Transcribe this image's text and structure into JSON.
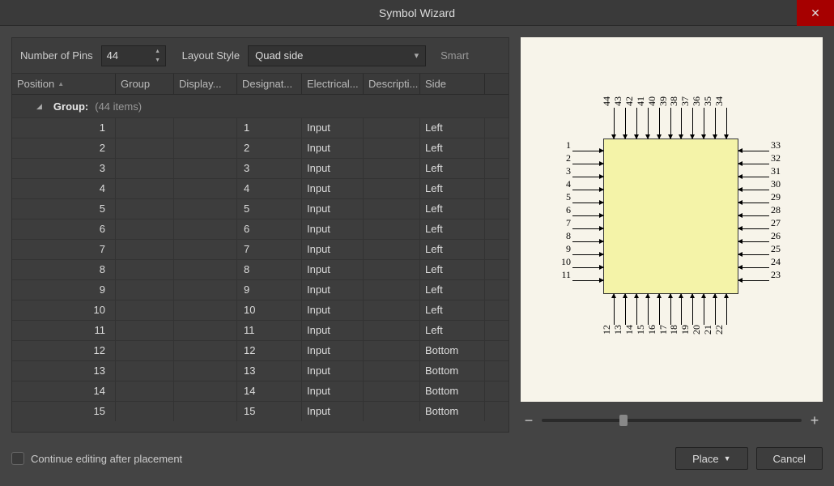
{
  "title": "Symbol Wizard",
  "toolbar": {
    "pins_label": "Number of Pins",
    "pins_value": "44",
    "layout_label": "Layout Style",
    "layout_value": "Quad side",
    "smart": "Smart"
  },
  "columns": {
    "position": "Position",
    "group": "Group",
    "display": "Display...",
    "designator": "Designat...",
    "electrical": "Electrical...",
    "description": "Descripti...",
    "side": "Side"
  },
  "group_header": {
    "label": "Group:",
    "count": "(44 items)"
  },
  "rows": [
    {
      "pos": "1",
      "desig": "1",
      "elec": "Input",
      "side": "Left"
    },
    {
      "pos": "2",
      "desig": "2",
      "elec": "Input",
      "side": "Left"
    },
    {
      "pos": "3",
      "desig": "3",
      "elec": "Input",
      "side": "Left"
    },
    {
      "pos": "4",
      "desig": "4",
      "elec": "Input",
      "side": "Left"
    },
    {
      "pos": "5",
      "desig": "5",
      "elec": "Input",
      "side": "Left"
    },
    {
      "pos": "6",
      "desig": "6",
      "elec": "Input",
      "side": "Left"
    },
    {
      "pos": "7",
      "desig": "7",
      "elec": "Input",
      "side": "Left"
    },
    {
      "pos": "8",
      "desig": "8",
      "elec": "Input",
      "side": "Left"
    },
    {
      "pos": "9",
      "desig": "9",
      "elec": "Input",
      "side": "Left"
    },
    {
      "pos": "10",
      "desig": "10",
      "elec": "Input",
      "side": "Left"
    },
    {
      "pos": "11",
      "desig": "11",
      "elec": "Input",
      "side": "Left"
    },
    {
      "pos": "12",
      "desig": "12",
      "elec": "Input",
      "side": "Bottom"
    },
    {
      "pos": "13",
      "desig": "13",
      "elec": "Input",
      "side": "Bottom"
    },
    {
      "pos": "14",
      "desig": "14",
      "elec": "Input",
      "side": "Bottom"
    },
    {
      "pos": "15",
      "desig": "15",
      "elec": "Input",
      "side": "Bottom"
    }
  ],
  "preview": {
    "left": [
      "1",
      "2",
      "3",
      "4",
      "5",
      "6",
      "7",
      "8",
      "9",
      "10",
      "11"
    ],
    "bottom": [
      "12",
      "13",
      "14",
      "15",
      "16",
      "17",
      "18",
      "19",
      "20",
      "21",
      "22"
    ],
    "right": [
      "33",
      "32",
      "31",
      "30",
      "29",
      "28",
      "27",
      "26",
      "25",
      "24",
      "23"
    ],
    "top": [
      "44",
      "43",
      "42",
      "41",
      "40",
      "39",
      "38",
      "37",
      "36",
      "35",
      "34"
    ]
  },
  "footer": {
    "continue": "Continue editing after placement",
    "place": "Place",
    "cancel": "Cancel"
  }
}
